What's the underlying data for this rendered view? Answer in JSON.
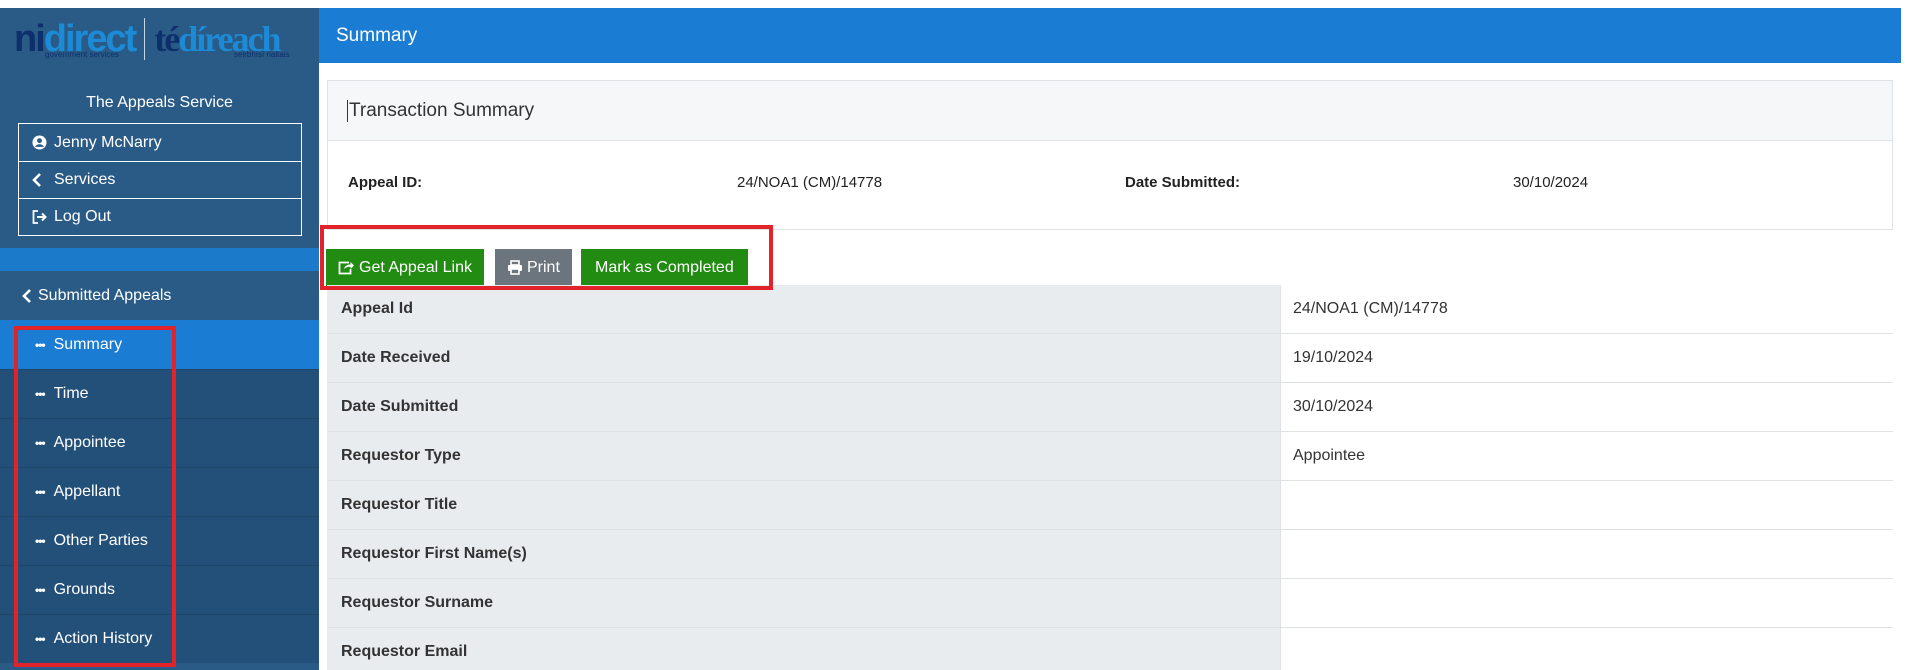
{
  "logo": {
    "ni_part1": "ni",
    "ni_part2": "direct",
    "ga_part1": "té",
    "ga_part2": "díreach",
    "sub_left": "government services",
    "sub_right": "seirbhísí rialtais"
  },
  "sidebar": {
    "service_name": "The Appeals Service",
    "user_menu": [
      {
        "label": "Jenny McNarry",
        "icon": "user-circle-icon"
      },
      {
        "label": "Services",
        "icon": "chevron-left-icon"
      },
      {
        "label": "Log Out",
        "icon": "sign-out-icon"
      }
    ],
    "back_link": "Submitted Appeals",
    "nav_items": [
      {
        "label": "Summary",
        "active": true
      },
      {
        "label": "Time"
      },
      {
        "label": "Appointee"
      },
      {
        "label": "Appellant"
      },
      {
        "label": "Other Parties"
      },
      {
        "label": "Grounds"
      },
      {
        "label": "Action History"
      }
    ],
    "nav_marker": "•••"
  },
  "header": {
    "title": "Summary"
  },
  "card": {
    "title": "Transaction Summary",
    "appeal_id_label": "Appeal ID:",
    "appeal_id_value": "24/NOA1 (CM)/14778",
    "date_submitted_label": "Date Submitted:",
    "date_submitted_value": "30/10/2024"
  },
  "actions": {
    "get_link": "Get Appeal Link",
    "print": "Print",
    "mark_completed": "Mark as Completed"
  },
  "details": [
    {
      "label": "Appeal Id",
      "value": "24/NOA1 (CM)/14778"
    },
    {
      "label": "Date Received",
      "value": "19/10/2024"
    },
    {
      "label": "Date Submitted",
      "value": "30/10/2024"
    },
    {
      "label": "Requestor Type",
      "value": "Appointee"
    },
    {
      "label": "Requestor Title",
      "value": ""
    },
    {
      "label": "Requestor First Name(s)",
      "value": ""
    },
    {
      "label": "Requestor Surname",
      "value": ""
    },
    {
      "label": "Requestor Email",
      "value": ""
    }
  ],
  "colors": {
    "sidebar": "#2a5b86",
    "accent_blue": "#1b7cd4",
    "button_green": "#218c11",
    "button_grey": "#6c757d",
    "highlight_red": "#e2232a"
  }
}
